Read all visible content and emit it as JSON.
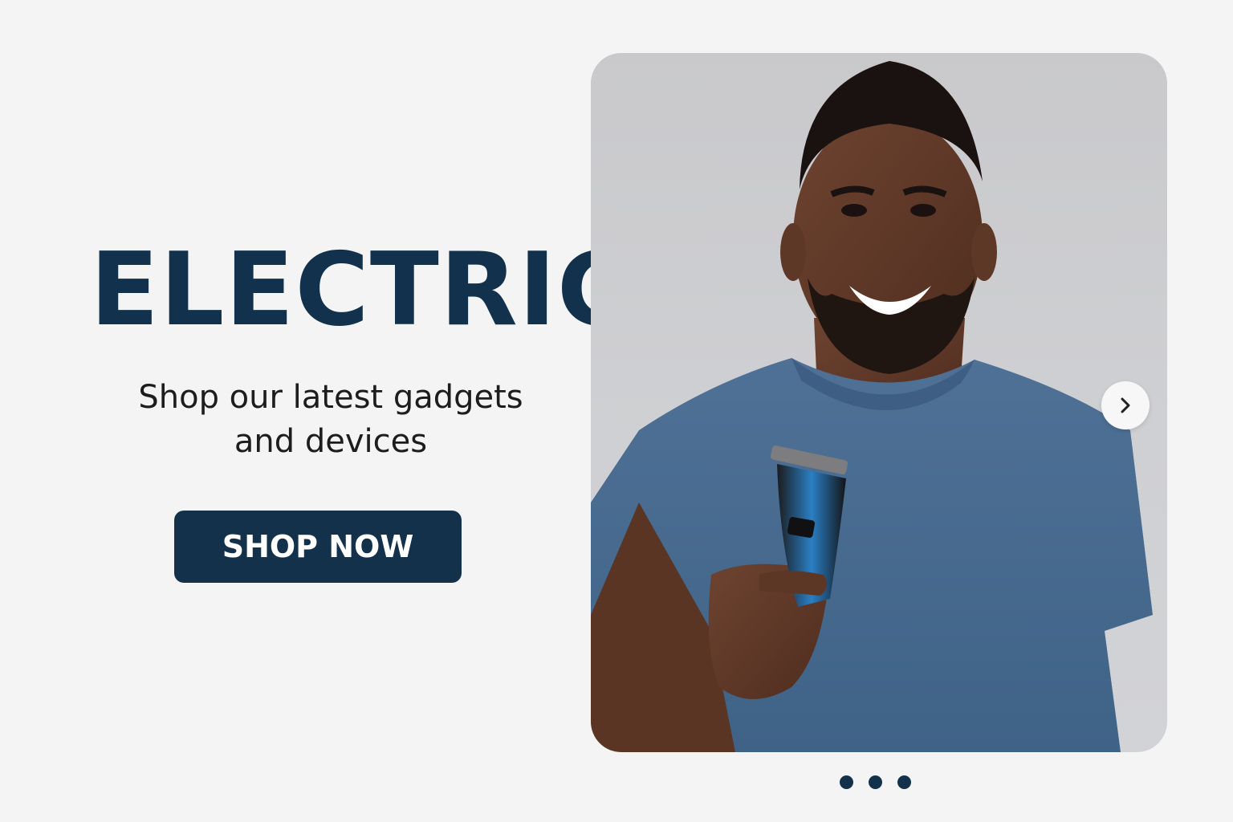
{
  "hero": {
    "title": "ELECTRIC",
    "subtitle_line1": "Shop our latest gadgets",
    "subtitle_line2": "and devices",
    "cta_label": "SHOP NOW"
  },
  "carousel": {
    "image": "man-holding-hair-clipper-photo",
    "next_icon": "chevron-right-icon",
    "dot_count": 3
  },
  "colors": {
    "brand_navy": "#12314c",
    "background": "#f4f4f4",
    "text_dark": "#1d1d1d",
    "button_text": "#ffffff"
  }
}
